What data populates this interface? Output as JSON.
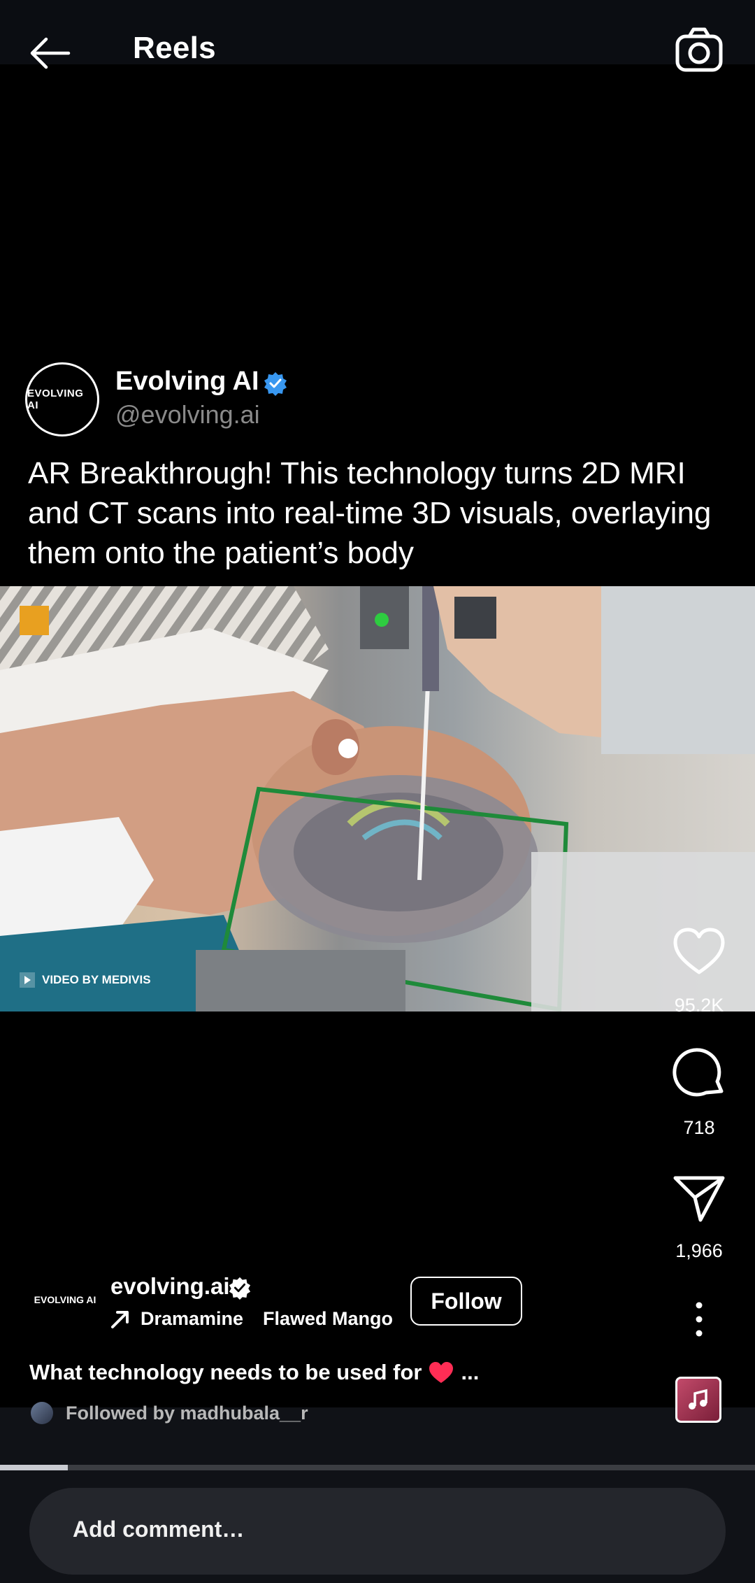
{
  "header": {
    "title": "Reels"
  },
  "post": {
    "account_name": "Evolving AI",
    "handle": "@evolving.ai",
    "avatar_text": "EVOLVING AI",
    "caption": "AR Breakthrough! This technology turns 2D MRI and CT scans into real-time 3D visuals, overlaying them onto the patient’s body",
    "video_credit": "VIDEO BY MEDIVIS"
  },
  "actions": {
    "likes": "95.2K",
    "comments": "718",
    "shares": "1,966"
  },
  "reel": {
    "username": "evolving.ai",
    "avatar_text": "EVOLVING AI",
    "audio_artist": "Dramamine",
    "audio_track": "Flawed Mango",
    "follow_label": "Follow",
    "caption": "What technology needs to be used for",
    "caption_more": "...",
    "followed_by": "Followed by madhubala__r"
  },
  "playback": {
    "progress": 0.09
  },
  "comment": {
    "placeholder": "Add comment…"
  },
  "colors": {
    "verified": "#3897f0",
    "heart": "#ff2d55",
    "overlay_green": "#1f8a3a"
  }
}
